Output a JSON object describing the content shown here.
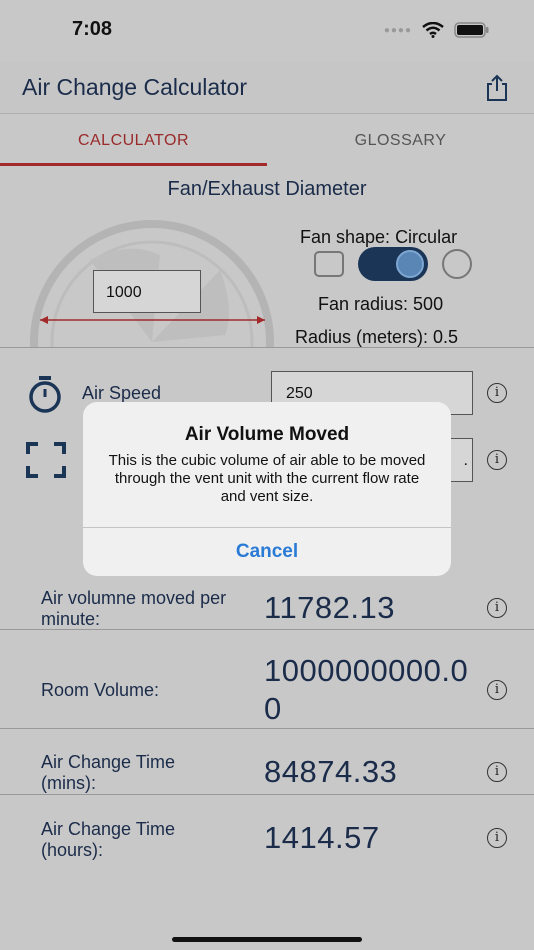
{
  "status": {
    "time": "7:08"
  },
  "nav": {
    "title": "Air Change Calculator"
  },
  "tabs": [
    {
      "label": "CALCULATOR"
    },
    {
      "label": "GLOSSARY"
    }
  ],
  "fan": {
    "section_title": "Fan/Exhaust Diameter",
    "diameter_value": "1000",
    "shape_label": "Fan shape: Circular",
    "radius_text": "Fan radius: 500",
    "radius_meters_text": "Radius (meters): 0.5"
  },
  "inputs": {
    "air_speed_label": "Air Speed",
    "air_speed_value": "250",
    "room_value": "."
  },
  "results": [
    {
      "label": "Air volumne moved per minute:",
      "value": "11782.13"
    },
    {
      "label": "Room Volume:",
      "value": "1000000000.00"
    },
    {
      "label": "Air Change Time (mins):",
      "value": "84874.33"
    },
    {
      "label": "Air Change Time (hours):",
      "value": "1414.57"
    }
  ],
  "dialog": {
    "title": "Air Volume Moved",
    "message": "This is the cubic volume of air able to be moved through the vent unit with the current flow rate and vent size.",
    "cancel_label": "Cancel"
  },
  "info_glyph": "i",
  "colors": {
    "accent_red": "#a32a2a",
    "navy": "#1b2c4a",
    "link_blue": "#2a7bd6"
  }
}
